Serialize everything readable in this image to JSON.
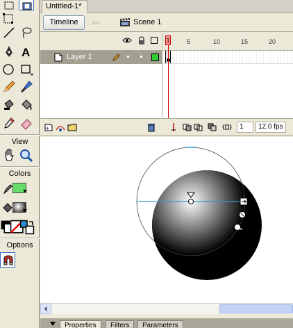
{
  "document": {
    "tab_title": "Untitled-1*"
  },
  "edit_bar": {
    "timeline_button": "Timeline",
    "scene_label": "Scene 1"
  },
  "tools": {
    "view_label": "View",
    "colors_label": "Colors",
    "options_label": "Options",
    "stroke_color": "#00CC00",
    "fill_style": "radial-gradient"
  },
  "timeline": {
    "layer_name": "Layer 1",
    "ruler": [
      "1",
      "5",
      "10",
      "15",
      "20"
    ],
    "current_frame": "1",
    "frame_rate": "12.0 fps",
    "layer_color": "#33CC33"
  },
  "stage": {
    "background": "#FFFFFF",
    "ball_color": "#000000",
    "highlight_color": "#FFFFFF",
    "gradient_handle_color": "#3399CC"
  },
  "properties": {
    "tabs": [
      "Properties",
      "Filters",
      "Parameters"
    ]
  }
}
